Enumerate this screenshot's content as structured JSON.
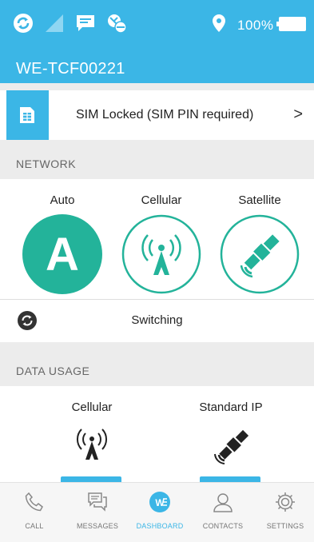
{
  "status_bar": {
    "icons": [
      "sync-icon",
      "signal-icon",
      "message-icon",
      "satellite-status-icon",
      "location-icon",
      "battery-icon"
    ],
    "battery": "100%"
  },
  "header": {
    "title": "WE-TCF00221"
  },
  "sim": {
    "label": "SIM Locked (SIM PIN required)",
    "chevron": ">"
  },
  "network": {
    "section_title": "NETWORK",
    "options": [
      {
        "label": "Auto",
        "glyph": "A",
        "selected": true
      },
      {
        "label": "Cellular",
        "selected": false
      },
      {
        "label": "Satellite",
        "selected": false
      }
    ],
    "status": "Switching"
  },
  "data_usage": {
    "section_title": "DATA USAGE",
    "items": [
      {
        "label": "Cellular"
      },
      {
        "label": "Standard IP"
      }
    ]
  },
  "tabs": [
    {
      "label": "CALL",
      "icon": "phone-icon"
    },
    {
      "label": "MESSAGES",
      "icon": "messages-icon"
    },
    {
      "label": "DASHBOARD",
      "icon": "dashboard-icon",
      "active": true
    },
    {
      "label": "CONTACTS",
      "icon": "contacts-icon"
    },
    {
      "label": "SETTINGS",
      "icon": "gear-icon"
    }
  ],
  "colors": {
    "header": "#3bb6e6",
    "accent": "#23b39a",
    "background": "#ececec"
  }
}
